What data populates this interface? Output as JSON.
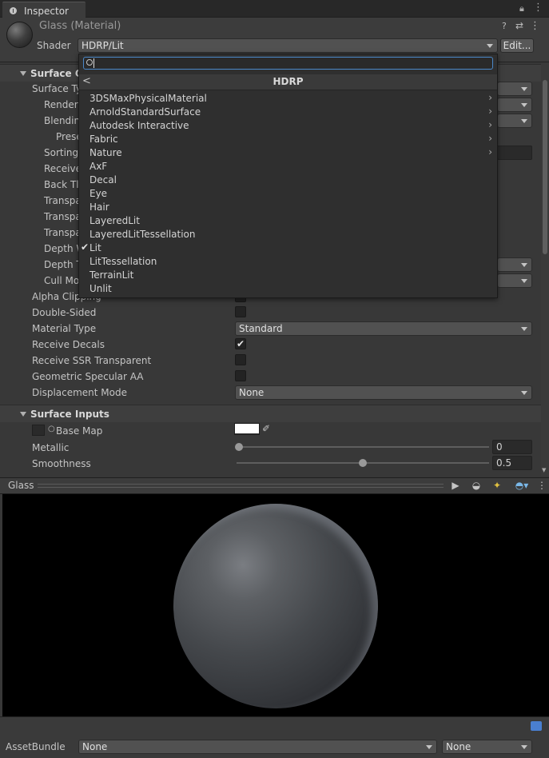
{
  "window": {
    "tab_label": "Inspector",
    "icons": [
      "lock-icon",
      "menu-icon"
    ]
  },
  "header": {
    "title": "Glass (Material)",
    "shader_label": "Shader",
    "shader_value": "HDRP/Lit",
    "edit_button": "Edit...",
    "icons": [
      "help-icon",
      "preset-icon",
      "more-icon"
    ]
  },
  "shader_popup": {
    "search_value": "",
    "title": "HDRP",
    "back_glyph": "<",
    "items": [
      {
        "label": "3DSMaxPhysicalMaterial",
        "submenu": true,
        "checked": false
      },
      {
        "label": "ArnoldStandardSurface",
        "submenu": true,
        "checked": false
      },
      {
        "label": "Autodesk Interactive",
        "submenu": true,
        "checked": false
      },
      {
        "label": "Fabric",
        "submenu": true,
        "checked": false
      },
      {
        "label": "Nature",
        "submenu": true,
        "checked": false
      },
      {
        "label": "AxF",
        "submenu": false,
        "checked": false
      },
      {
        "label": "Decal",
        "submenu": false,
        "checked": false
      },
      {
        "label": "Eye",
        "submenu": false,
        "checked": false
      },
      {
        "label": "Hair",
        "submenu": false,
        "checked": false
      },
      {
        "label": "LayeredLit",
        "submenu": false,
        "checked": false
      },
      {
        "label": "LayeredLitTessellation",
        "submenu": false,
        "checked": false
      },
      {
        "label": "Lit",
        "submenu": false,
        "checked": true
      },
      {
        "label": "LitTessellation",
        "submenu": false,
        "checked": false
      },
      {
        "label": "TerrainLit",
        "submenu": false,
        "checked": false
      },
      {
        "label": "Unlit",
        "submenu": false,
        "checked": false
      }
    ]
  },
  "surface_options": {
    "title": "Surface O",
    "rows_partial": [
      "Surface Ty",
      "Renderi",
      "Blendin",
      "Prese",
      "Sorting",
      "Receive",
      "Back Tl",
      "Transpa",
      "Transpa",
      "Transpa",
      "Depth W",
      "Depth T",
      "Cull Mo"
    ],
    "alpha_clipping": "Alpha Clipping",
    "double_sided": "Double-Sided",
    "material_type_label": "Material Type",
    "material_type_value": "Standard",
    "receive_decals_label": "Receive Decals",
    "receive_decals_checked": true,
    "receive_ssr_label": "Receive SSR Transparent",
    "geometric_aa_label": "Geometric Specular AA",
    "displacement_label": "Displacement Mode",
    "displacement_value": "None"
  },
  "surface_inputs": {
    "title": "Surface Inputs",
    "base_map_label": "Base Map",
    "base_map_color": "#ffffff",
    "metallic_label": "Metallic",
    "metallic_value": "0",
    "metallic_fraction": 0,
    "smoothness_label": "Smoothness",
    "smoothness_value": "0.5",
    "smoothness_fraction": 0.5
  },
  "preview": {
    "title": "Glass"
  },
  "footer": {
    "asset_bundle_label": "AssetBundle",
    "asset_bundle_value": "None",
    "variant_value": "None"
  }
}
